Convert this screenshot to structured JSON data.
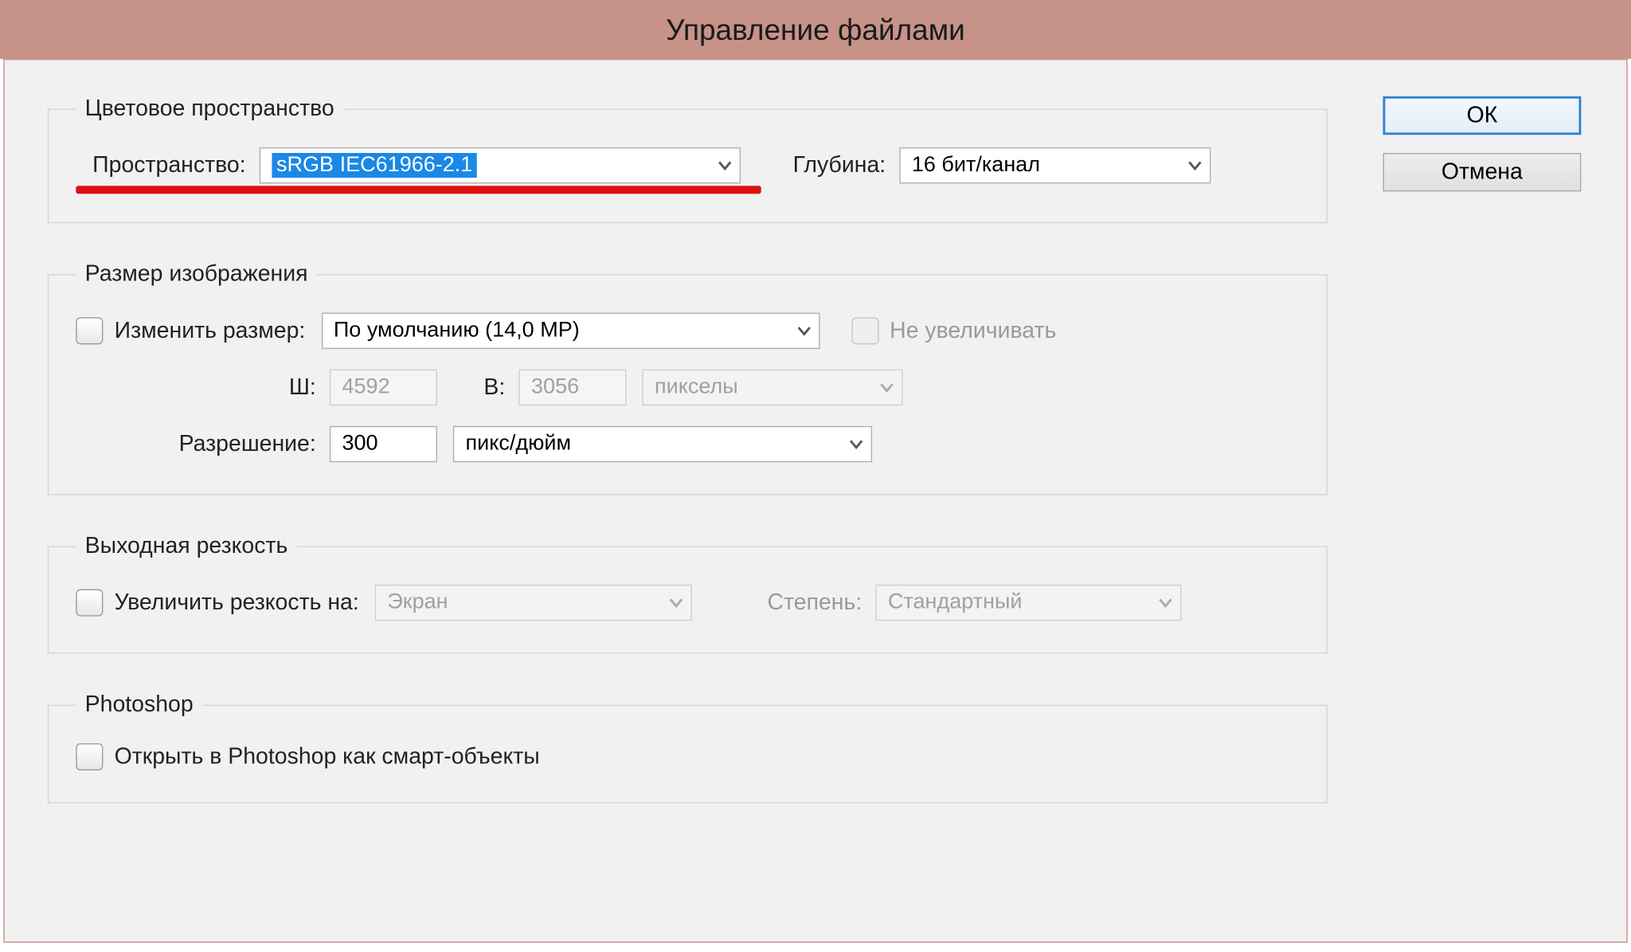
{
  "window": {
    "title": "Управление файлами"
  },
  "buttons": {
    "ok": "ОК",
    "cancel": "Отмена"
  },
  "color_space": {
    "legend": "Цветовое пространство",
    "space_label": "Пространство:",
    "space_value": "sRGB IEC61966-2.1",
    "depth_label": "Глубина:",
    "depth_value": "16 бит/канал"
  },
  "image_size": {
    "legend": "Размер изображения",
    "resize_label": "Изменить размер:",
    "resize_value": "По умолчанию (14,0 МР)",
    "no_upscale_label": "Не увеличивать",
    "w_label": "Ш:",
    "w_value": "4592",
    "h_label": "В:",
    "h_value": "3056",
    "unit_value": "пикселы",
    "resolution_label": "Разрешение:",
    "resolution_value": "300",
    "resolution_unit": "пикс/дюйм"
  },
  "output_sharpening": {
    "legend": "Выходная резкость",
    "sharpen_for_label": "Увеличить резкость на:",
    "sharpen_for_value": "Экран",
    "amount_label": "Степень:",
    "amount_value": "Стандартный"
  },
  "photoshop": {
    "legend": "Photoshop",
    "smart_objects_label": "Открыть в Photoshop как смарт-объекты"
  }
}
